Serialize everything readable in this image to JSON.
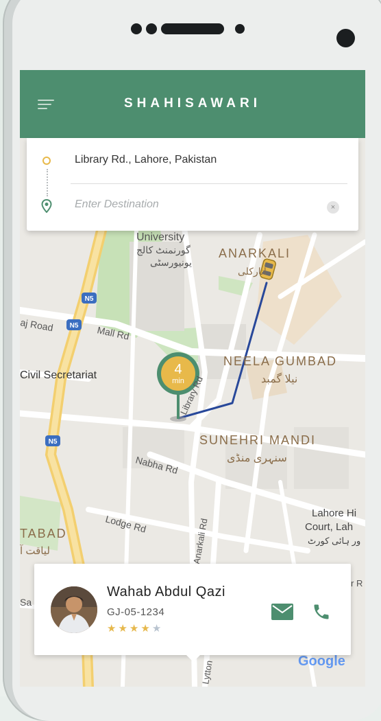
{
  "app": {
    "title": "SHAHISAWARI"
  },
  "search": {
    "origin": "Library Rd., Lahore, Pakistan",
    "destination_placeholder": "Enter Destination",
    "destination_value": "",
    "clear_label": "×"
  },
  "map": {
    "labels": {
      "university": "University",
      "university_urdu_1": "گورنمنٹ کالج",
      "university_urdu_2": "یونیورسٹی",
      "anarkali": "ANARKALI",
      "anarkali_urdu": "انارکلی",
      "neela_gumbad": "NEELA GUMBAD",
      "neela_gumbad_urdu": "نیلا گمبد",
      "sunehri_mandi": "SUNEHRI MANDI",
      "sunehri_mandi_urdu": "سنہری منڈی",
      "civil_secretariat": "Civil Secretariat",
      "mall_rd": "Mall Rd",
      "library_rd": "Library Rd",
      "nabha_rd": "Nabha Rd",
      "lodge_rd": "Lodge Rd",
      "anarkali_rd": "Anarkali Rd",
      "taj_road": "aj Road",
      "lahore_high_court_1": "Lahore Hi",
      "lahore_high_court_2": "Court, Lah",
      "lahore_high_court_urdu": "ور ہائی کورٹ",
      "tabad": "TABAD",
      "tabad_urdu": "لیاقت آ",
      "lytton": "Lytton",
      "sa": "Sa",
      "r": "r R",
      "n5": "N5",
      "google": "Google"
    },
    "eta": {
      "value": "4",
      "unit": "min"
    }
  },
  "driver": {
    "name": "Wahab Abdul Qazi",
    "plate": "GJ-05-1234",
    "rating": 4,
    "max_rating": 5,
    "star_glyph": "★"
  },
  "colors": {
    "brand": "#4d8e6f",
    "route": "#28489a",
    "eta_marker": "#e8b94a",
    "star_on": "#e6b84c",
    "star_off": "#b8c3cf"
  }
}
